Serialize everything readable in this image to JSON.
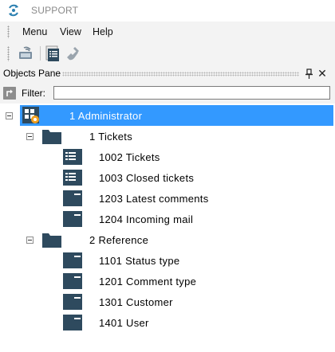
{
  "window": {
    "title": "SUPPORT"
  },
  "menu": {
    "items": [
      "Menu",
      "View",
      "Help"
    ]
  },
  "pane": {
    "title": "Objects Pane",
    "pin_label": "",
    "close_glyph": "✕"
  },
  "filter": {
    "label": "Filter:",
    "value": "",
    "placeholder": ""
  },
  "colors": {
    "selection": "#3399ff",
    "folder": "#2e4a5e",
    "accent_badge": "#f0a020"
  },
  "tree": {
    "root": {
      "label": "1 Administrator",
      "selected": true,
      "expanded": true
    },
    "groups": [
      {
        "label": "1 Tickets",
        "expanded": true,
        "items": [
          {
            "label": "1002 Tickets",
            "icon": "list-form-icon"
          },
          {
            "label": "1003 Closed tickets",
            "icon": "list-form-icon"
          },
          {
            "label": "1203 Latest comments",
            "icon": "form-icon"
          },
          {
            "label": "1204 Incoming mail",
            "icon": "form-icon"
          }
        ]
      },
      {
        "label": "2 Reference",
        "expanded": true,
        "items": [
          {
            "label": "1101 Status type",
            "icon": "form-icon"
          },
          {
            "label": "1201 Comment type",
            "icon": "form-icon"
          },
          {
            "label": "1301 Customer",
            "icon": "form-icon"
          },
          {
            "label": "1401 User",
            "icon": "form-icon"
          }
        ]
      }
    ]
  }
}
